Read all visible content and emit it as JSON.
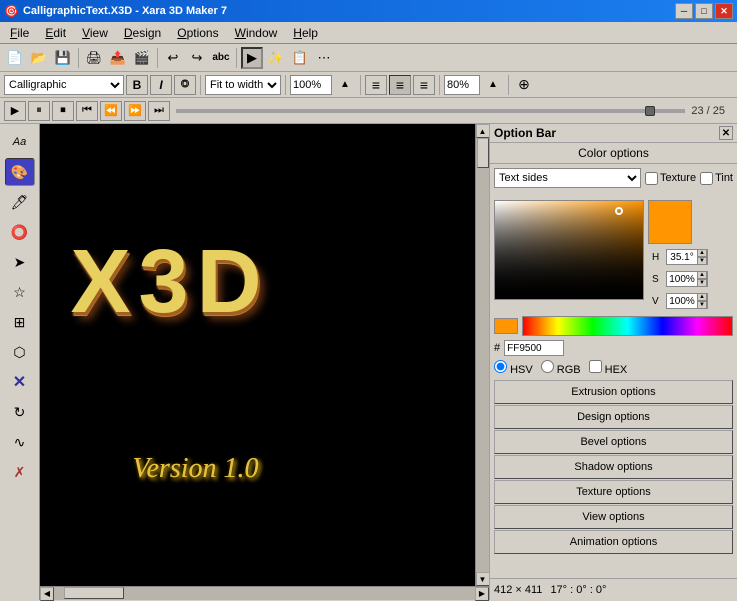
{
  "window": {
    "title": "CalligraphicText.X3D - Xara 3D Maker 7",
    "icon": "📝"
  },
  "menu": {
    "items": [
      "File",
      "Edit",
      "View",
      "Design",
      "Options",
      "Window",
      "Help"
    ]
  },
  "toolbar2": {
    "font": "Calligraphic",
    "bold": "B",
    "italic": "I",
    "outline": "O",
    "fit_label": "Fit to width",
    "zoom": "100%"
  },
  "player": {
    "frame_count": "23 / 25"
  },
  "right_panel": {
    "header": "Option Bar",
    "sections": {
      "color_options": "Color options",
      "dropdown_value": "Text sides",
      "texture_label": "Texture",
      "tint_label": "Tint",
      "h_label": "H",
      "h_value": "35.1°",
      "s_label": "S",
      "s_value": "100%",
      "v_label": "V",
      "v_value": "100%",
      "hex_label": "#",
      "hex_value": "FF9500",
      "hsv_label": "HSV",
      "rgb_label": "RGB",
      "hex_radio_label": "HEX"
    },
    "buttons": [
      "Extrusion options",
      "Design options",
      "Bevel options",
      "Shadow options",
      "Texture options",
      "View options",
      "Animation options"
    ]
  },
  "canvas": {
    "x3d_text": "X3D",
    "version_text": "Version 1.0"
  },
  "status": {
    "text": "",
    "dimensions": "412 × 411",
    "angles": "17° : 0° : 0°"
  }
}
